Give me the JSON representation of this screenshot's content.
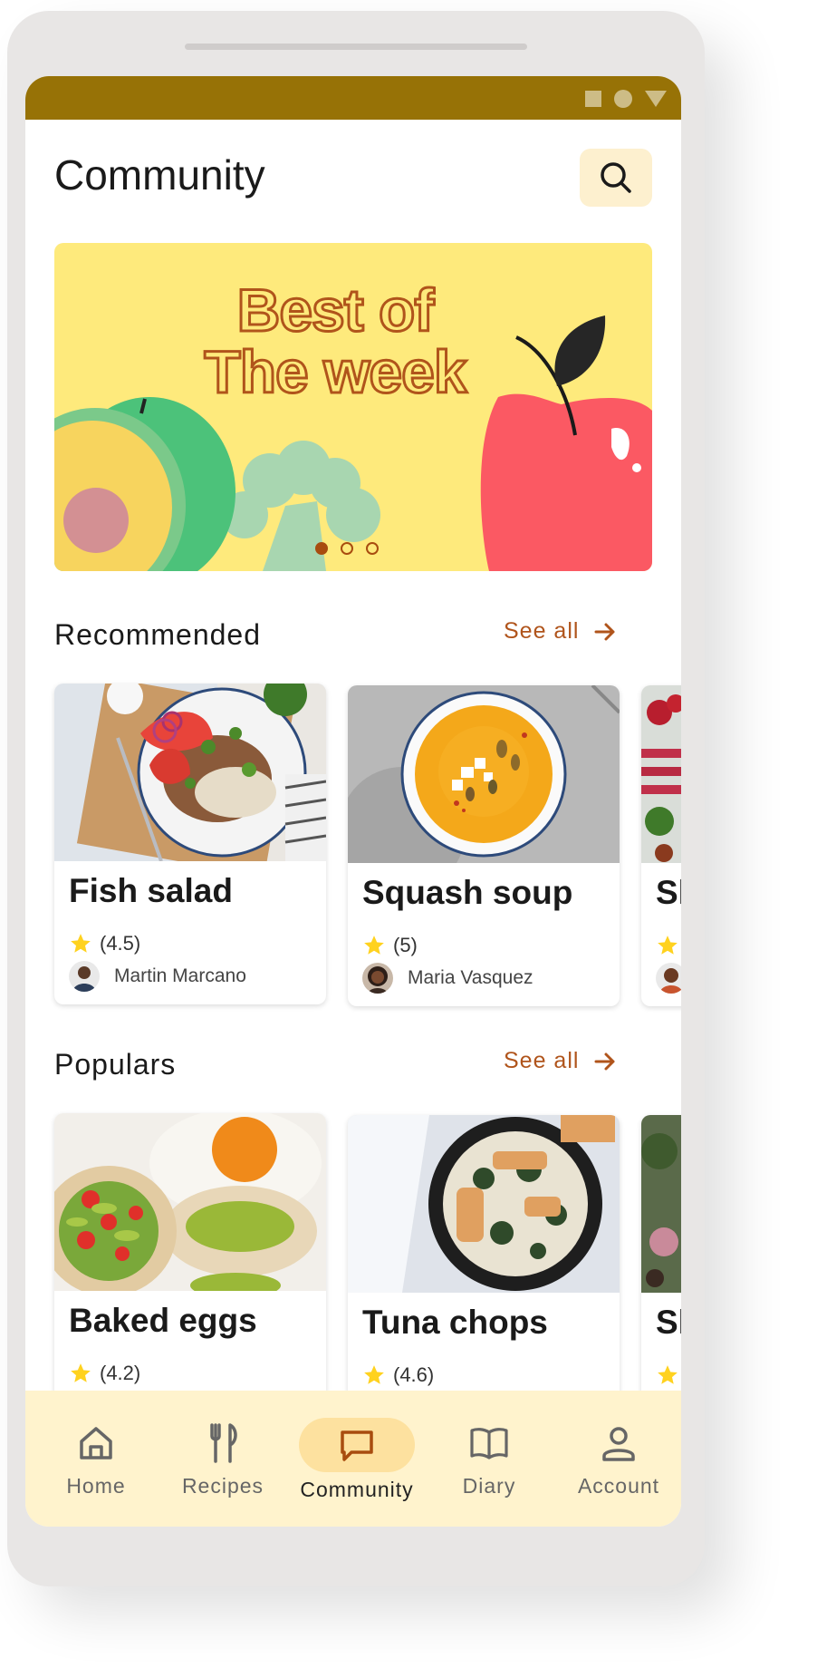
{
  "header": {
    "title": "Community"
  },
  "banner": {
    "title_line1": "Best of",
    "title_line2": "The week",
    "slides": 3,
    "active_slide": 1
  },
  "sections": {
    "recommended": {
      "title": "Recommended",
      "see_all": "See all",
      "cards": [
        {
          "name": "Fish salad",
          "rating": "(4.5)",
          "author": "Martin Marcano"
        },
        {
          "name": "Squash soup",
          "rating": "(5)",
          "author": "Maria Vasquez"
        },
        {
          "name": "Sl",
          "rating": "",
          "author": ""
        }
      ]
    },
    "populars": {
      "title": "Populars",
      "see_all": "See all",
      "cards": [
        {
          "name": "Baked eggs",
          "rating": "(4.2)"
        },
        {
          "name": "Tuna chops",
          "rating": "(4.6)"
        },
        {
          "name": "Sl",
          "rating": ""
        }
      ]
    }
  },
  "nav": {
    "items": [
      {
        "label": "Home",
        "icon": "home-icon"
      },
      {
        "label": "Recipes",
        "icon": "fork-knife-icon"
      },
      {
        "label": "Community",
        "icon": "chat-icon",
        "active": true
      },
      {
        "label": "Diary",
        "icon": "book-icon"
      },
      {
        "label": "Account",
        "icon": "person-icon"
      }
    ]
  },
  "colors": {
    "status_bar": "#977206",
    "accent": "#b0541b",
    "banner_bg": "#feea7c",
    "nav_bg": "#fff3cd",
    "nav_active": "#fde19f",
    "star": "#ffd21f"
  }
}
